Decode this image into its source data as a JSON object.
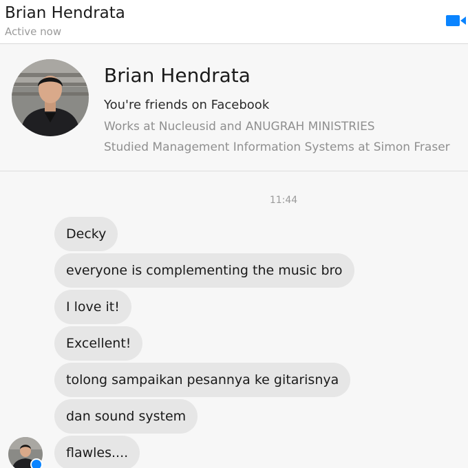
{
  "header": {
    "name": "Brian Hendrata",
    "status": "Active now",
    "video_icon": "video-camera-icon",
    "accent_color": "#0a84ff"
  },
  "profile": {
    "name": "Brian Hendrata",
    "friends_text": "You're friends on Facebook",
    "work": "Works at Nucleusid and ANUGRAH MINISTRIES",
    "study": "Studied Management Information Systems at Simon Fraser"
  },
  "chat": {
    "timestamp": "11:44",
    "messages": [
      "Decky",
      "everyone is complementing the music bro",
      "I love it!",
      "Excellent!",
      "tolong sampaikan pesannya ke gitarisnya",
      "dan sound system",
      "flawles...."
    ],
    "bubble_color": "#e6e6e6"
  }
}
